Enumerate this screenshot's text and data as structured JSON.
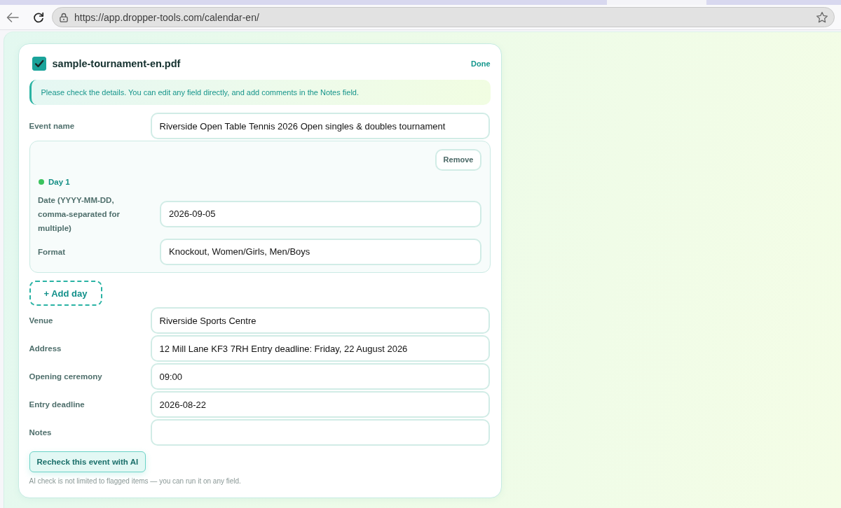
{
  "browser": {
    "url": "https://app.dropper-tools.com/calendar-en/"
  },
  "file": {
    "name": "sample-tournament-en.pdf",
    "checked": true,
    "action": "Done"
  },
  "notice": "Please check the details. You can edit any field directly, and add comments in the Notes field.",
  "event_fields": [
    {
      "label": "Event name",
      "value": "Riverside Open Table Tennis 2026 Open singles & doubles tournament"
    }
  ],
  "days": [
    {
      "title": "Day 1",
      "remove_label": "Remove",
      "fields": [
        {
          "label": "Date (YYYY-MM-DD, comma-separated for multiple)",
          "value": "2026-09-05"
        },
        {
          "label": "Format",
          "value": "Knockout, Women/Girls, Men/Boys"
        }
      ]
    }
  ],
  "add_day_label": "+ Add day",
  "detail_fields": [
    {
      "label": "Venue",
      "value": "Riverside Sports Centre"
    },
    {
      "label": "Address",
      "value": "12 Mill Lane KF3 7RH Entry deadline: Friday, 22 August 2026"
    },
    {
      "label": "Opening ceremony",
      "value": "09:00"
    },
    {
      "label": "Entry deadline",
      "value": "2026-08-22"
    },
    {
      "label": "Notes"
    }
  ],
  "recheck_button": "Recheck this event with AI",
  "footnote": "AI check is not limited to flagged items — you can run it on any field."
}
